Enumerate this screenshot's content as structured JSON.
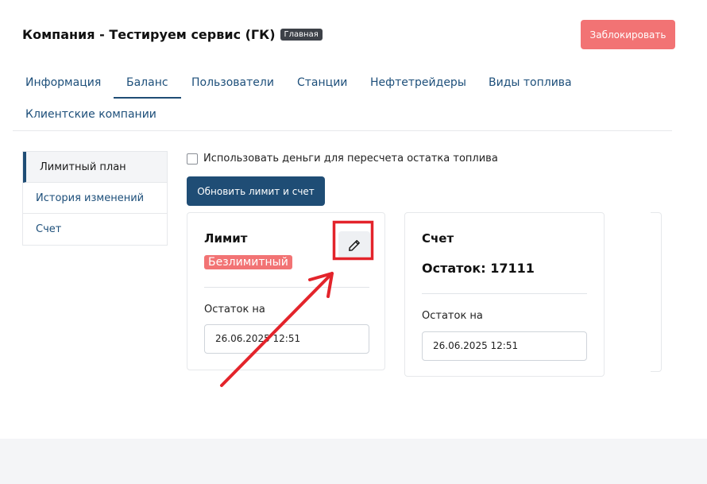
{
  "header": {
    "company_title": "Компания - Тестируем сервис (ГК)",
    "main_badge": "Главная",
    "block_button": "Заблокировать"
  },
  "tabs": [
    {
      "label": "Информация",
      "active": false
    },
    {
      "label": "Баланс",
      "active": true
    },
    {
      "label": "Пользователи",
      "active": false
    },
    {
      "label": "Станции",
      "active": false
    },
    {
      "label": "Нефтетрейдеры",
      "active": false
    },
    {
      "label": "Виды топлива",
      "active": false
    },
    {
      "label": "Клиентские компании",
      "active": false
    }
  ],
  "side_nav": [
    {
      "label": "Лимитный план",
      "active": true
    },
    {
      "label": "История изменений",
      "active": false
    },
    {
      "label": "Счет",
      "active": false
    }
  ],
  "controls": {
    "use_money_checkbox_label": "Использовать деньги для пересчета остатка топлива",
    "use_money_checked": false,
    "update_button": "Обновить лимит и счет"
  },
  "limit_card": {
    "title": "Лимит",
    "badge": "Безлимитный",
    "edit_icon": "pencil-icon",
    "remainder_label": "Остаток на",
    "date_value": "26.06.2025 12:51"
  },
  "account_card": {
    "title": "Счет",
    "balance": "Остаток: 17111",
    "remainder_label": "Остаток на",
    "date_value": "26.06.2025 12:51"
  },
  "colors": {
    "primary": "#1f4d75",
    "danger": "#f27374",
    "badge_dark": "#3d4148",
    "annotation": "#e3242b"
  }
}
